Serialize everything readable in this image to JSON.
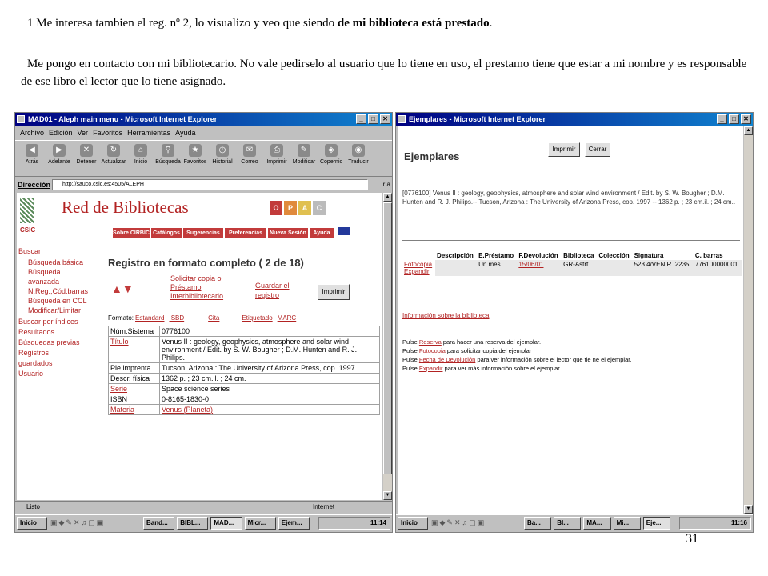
{
  "captions": {
    "line1_prefix": "1  Me interesa tambien el reg. nº 2, lo visualizo y veo que siendo",
    "line1_bold": "de mi biblioteca está prestado",
    "line1_end": ".",
    "line2": "Me pongo en contacto con mi bibliotecario. No vale pedirselo al usuario que lo tiene en uso, el prestamo tiene que estar a mi nombre y es responsable de ese libro el lector que lo tiene asignado.",
    "page_number": "31"
  },
  "left_window": {
    "title": "MAD01 - Aleph main menu - Microsoft Internet Explorer",
    "menu": [
      "Archivo",
      "Edición",
      "Ver",
      "Favoritos",
      "Herramientas",
      "Ayuda"
    ],
    "toolbar": [
      "Atrás",
      "Adelante",
      "Detener",
      "Actualizar",
      "Inicio",
      "Búsqueda",
      "Favoritos",
      "Historial",
      "Correo",
      "Imprimir",
      "Modificar",
      "Copernic",
      "Traducir"
    ],
    "address_label": "Dirección",
    "address_value": "http://sauco.csic.es:4505/ALEPH",
    "go_label": "Ir a",
    "brand": "Red de Bibliotecas",
    "csic": "CSIC",
    "opac_letters": [
      "O",
      "P",
      "A",
      "C"
    ],
    "tabs": [
      "Sobre CIRBIC",
      "Catálogos",
      "Sugerencias",
      "Preferencias",
      "Nueva Sesión",
      "Ayuda"
    ],
    "nav": {
      "buscar": "Buscar",
      "busqueda_basica": "Búsqueda básica",
      "busqueda_avanzada_1": "Búsqueda",
      "busqueda_avanzada_2": "avanzada",
      "nreg": "N.Reg.,Cód.barras",
      "ccl": "Búsqueda en CCL",
      "modificar": "Modificar/Limitar",
      "indices": "Buscar por índices",
      "resultados": "Resultados",
      "previas": "Búsquedas previas",
      "registros_1": "Registros",
      "registros_2": "guardados",
      "usuario": "Usuario"
    },
    "record_title": "Registro en formato completo ( 2 de 18)",
    "solicitar": [
      "Solicitar copia o",
      "Préstamo",
      "Interbibliotecario"
    ],
    "guardar": [
      "Guardar el",
      "registro"
    ],
    "imprimir": "Imprimir",
    "formato_label": "Formato:",
    "formatos": [
      "Estandard",
      "ISBD",
      "Cita",
      "Etiquetado",
      "MARC"
    ],
    "record": [
      {
        "label": "Núm.Sistema",
        "value": "0776100",
        "label_link": false,
        "value_link": false
      },
      {
        "label": "Título",
        "value": "Venus II : geology, geophysics, atmosphere and solar wind environment / Edit. by S. W. Bougher ; D.M. Hunten and R. J. Philips.",
        "label_link": true,
        "value_link": false
      },
      {
        "label": "Pie imprenta",
        "value": "Tucson, Arizona : The University of Arizona Press, cop. 1997.",
        "label_link": false,
        "value_link": false
      },
      {
        "label": "Descr. física",
        "value": "1362 p. ; 23 cm.il. ; 24 cm.",
        "label_link": false,
        "value_link": false
      },
      {
        "label": "Serie",
        "value": "Space science series",
        "label_link": true,
        "value_link": false
      },
      {
        "label": "ISBN",
        "value": "0-8165-1830-0",
        "label_link": false,
        "value_link": false
      },
      {
        "label": "Materia",
        "value": "Venus (Planeta)",
        "label_link": true,
        "value_link": true
      }
    ],
    "status_left": "Listo",
    "status_right": "Internet",
    "taskbar": {
      "start": "Inicio",
      "tasks": [
        "Band...",
        "BIBL...",
        "MAD...",
        "Micr...",
        "Ejem..."
      ],
      "clock": "11:14"
    }
  },
  "right_window": {
    "title": "Ejemplares - Microsoft Internet Explorer",
    "heading": "Ejemplares",
    "buttons": [
      "Imprimir",
      "Cerrar"
    ],
    "description": "[0776100] Venus II : geology, geophysics, atmosphere and solar wind environment / Edit. by S. W. Bougher ; D.M. Hunten and R. J. Philips.-- Tucson, Arizona : The University of Arizona Press, cop. 1997 -- 1362 p. ; 23 cm.il. ; 24 cm..",
    "columns": [
      "Descripción",
      "E.Préstamo",
      "F.Devolución",
      "Biblioteca",
      "Colección",
      "Signatura",
      "C. barras"
    ],
    "row": {
      "links": [
        "Fotocopia",
        "Expandir"
      ],
      "descripcion": "",
      "prestamo": "Un mes",
      "devolucion": "15/06/01",
      "biblioteca": "GR-Astrf",
      "coleccion": "",
      "signatura": "523.4/VEN R. 2235",
      "cbarras": "776100000001"
    },
    "info_link": "Información sobre la biblioteca",
    "help": [
      {
        "pre": "Pulse ",
        "link": "Reserva",
        "post": " para hacer una reserva del ejemplar."
      },
      {
        "pre": "Pulse ",
        "link": "Fotocopia",
        "post": " para solicitar copia del ejemplar"
      },
      {
        "pre": "Pulse ",
        "link": "Fecha de Devolución",
        "post": " para ver información sobre el lector que tie ne el ejemplar."
      },
      {
        "pre": "Pulse ",
        "link": "Expandir",
        "post": " para ver más información sobre el ejemplar."
      }
    ],
    "taskbar": {
      "start": "Inicio",
      "tasks": [
        "Ba...",
        "BI...",
        "MA...",
        "Mi...",
        "Eje..."
      ],
      "clock": "11:16"
    }
  },
  "colors": {
    "link": "#b22222",
    "titlebar": "#000080",
    "brand": "#b22222"
  }
}
